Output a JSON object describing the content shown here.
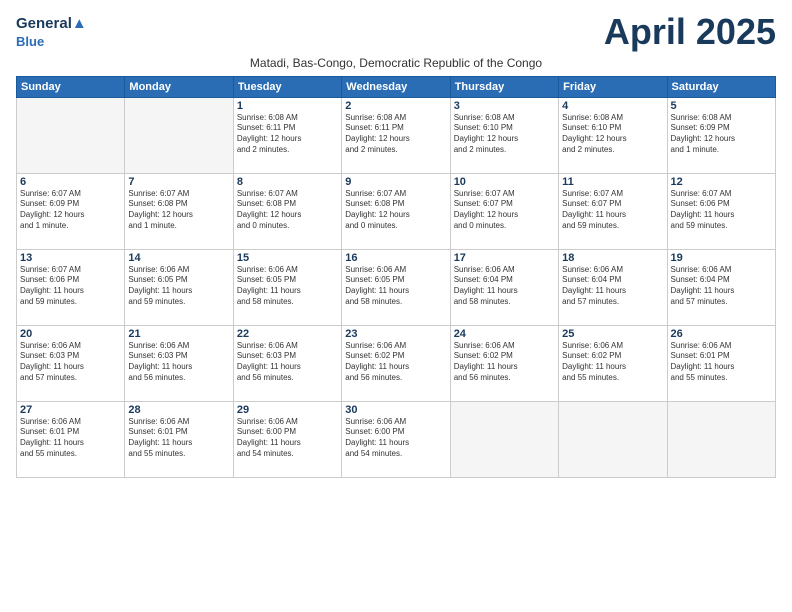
{
  "header": {
    "logo_line1": "General",
    "logo_line2": "Blue",
    "month_title": "April 2025",
    "location": "Matadi, Bas-Congo, Democratic Republic of the Congo"
  },
  "weekdays": [
    "Sunday",
    "Monday",
    "Tuesday",
    "Wednesday",
    "Thursday",
    "Friday",
    "Saturday"
  ],
  "weeks": [
    [
      {
        "day": "",
        "info": ""
      },
      {
        "day": "",
        "info": ""
      },
      {
        "day": "1",
        "info": "Sunrise: 6:08 AM\nSunset: 6:11 PM\nDaylight: 12 hours\nand 2 minutes."
      },
      {
        "day": "2",
        "info": "Sunrise: 6:08 AM\nSunset: 6:11 PM\nDaylight: 12 hours\nand 2 minutes."
      },
      {
        "day": "3",
        "info": "Sunrise: 6:08 AM\nSunset: 6:10 PM\nDaylight: 12 hours\nand 2 minutes."
      },
      {
        "day": "4",
        "info": "Sunrise: 6:08 AM\nSunset: 6:10 PM\nDaylight: 12 hours\nand 2 minutes."
      },
      {
        "day": "5",
        "info": "Sunrise: 6:08 AM\nSunset: 6:09 PM\nDaylight: 12 hours\nand 1 minute."
      }
    ],
    [
      {
        "day": "6",
        "info": "Sunrise: 6:07 AM\nSunset: 6:09 PM\nDaylight: 12 hours\nand 1 minute."
      },
      {
        "day": "7",
        "info": "Sunrise: 6:07 AM\nSunset: 6:08 PM\nDaylight: 12 hours\nand 1 minute."
      },
      {
        "day": "8",
        "info": "Sunrise: 6:07 AM\nSunset: 6:08 PM\nDaylight: 12 hours\nand 0 minutes."
      },
      {
        "day": "9",
        "info": "Sunrise: 6:07 AM\nSunset: 6:08 PM\nDaylight: 12 hours\nand 0 minutes."
      },
      {
        "day": "10",
        "info": "Sunrise: 6:07 AM\nSunset: 6:07 PM\nDaylight: 12 hours\nand 0 minutes."
      },
      {
        "day": "11",
        "info": "Sunrise: 6:07 AM\nSunset: 6:07 PM\nDaylight: 11 hours\nand 59 minutes."
      },
      {
        "day": "12",
        "info": "Sunrise: 6:07 AM\nSunset: 6:06 PM\nDaylight: 11 hours\nand 59 minutes."
      }
    ],
    [
      {
        "day": "13",
        "info": "Sunrise: 6:07 AM\nSunset: 6:06 PM\nDaylight: 11 hours\nand 59 minutes."
      },
      {
        "day": "14",
        "info": "Sunrise: 6:06 AM\nSunset: 6:05 PM\nDaylight: 11 hours\nand 59 minutes."
      },
      {
        "day": "15",
        "info": "Sunrise: 6:06 AM\nSunset: 6:05 PM\nDaylight: 11 hours\nand 58 minutes."
      },
      {
        "day": "16",
        "info": "Sunrise: 6:06 AM\nSunset: 6:05 PM\nDaylight: 11 hours\nand 58 minutes."
      },
      {
        "day": "17",
        "info": "Sunrise: 6:06 AM\nSunset: 6:04 PM\nDaylight: 11 hours\nand 58 minutes."
      },
      {
        "day": "18",
        "info": "Sunrise: 6:06 AM\nSunset: 6:04 PM\nDaylight: 11 hours\nand 57 minutes."
      },
      {
        "day": "19",
        "info": "Sunrise: 6:06 AM\nSunset: 6:04 PM\nDaylight: 11 hours\nand 57 minutes."
      }
    ],
    [
      {
        "day": "20",
        "info": "Sunrise: 6:06 AM\nSunset: 6:03 PM\nDaylight: 11 hours\nand 57 minutes."
      },
      {
        "day": "21",
        "info": "Sunrise: 6:06 AM\nSunset: 6:03 PM\nDaylight: 11 hours\nand 56 minutes."
      },
      {
        "day": "22",
        "info": "Sunrise: 6:06 AM\nSunset: 6:03 PM\nDaylight: 11 hours\nand 56 minutes."
      },
      {
        "day": "23",
        "info": "Sunrise: 6:06 AM\nSunset: 6:02 PM\nDaylight: 11 hours\nand 56 minutes."
      },
      {
        "day": "24",
        "info": "Sunrise: 6:06 AM\nSunset: 6:02 PM\nDaylight: 11 hours\nand 56 minutes."
      },
      {
        "day": "25",
        "info": "Sunrise: 6:06 AM\nSunset: 6:02 PM\nDaylight: 11 hours\nand 55 minutes."
      },
      {
        "day": "26",
        "info": "Sunrise: 6:06 AM\nSunset: 6:01 PM\nDaylight: 11 hours\nand 55 minutes."
      }
    ],
    [
      {
        "day": "27",
        "info": "Sunrise: 6:06 AM\nSunset: 6:01 PM\nDaylight: 11 hours\nand 55 minutes."
      },
      {
        "day": "28",
        "info": "Sunrise: 6:06 AM\nSunset: 6:01 PM\nDaylight: 11 hours\nand 55 minutes."
      },
      {
        "day": "29",
        "info": "Sunrise: 6:06 AM\nSunset: 6:00 PM\nDaylight: 11 hours\nand 54 minutes."
      },
      {
        "day": "30",
        "info": "Sunrise: 6:06 AM\nSunset: 6:00 PM\nDaylight: 11 hours\nand 54 minutes."
      },
      {
        "day": "",
        "info": ""
      },
      {
        "day": "",
        "info": ""
      },
      {
        "day": "",
        "info": ""
      }
    ]
  ]
}
